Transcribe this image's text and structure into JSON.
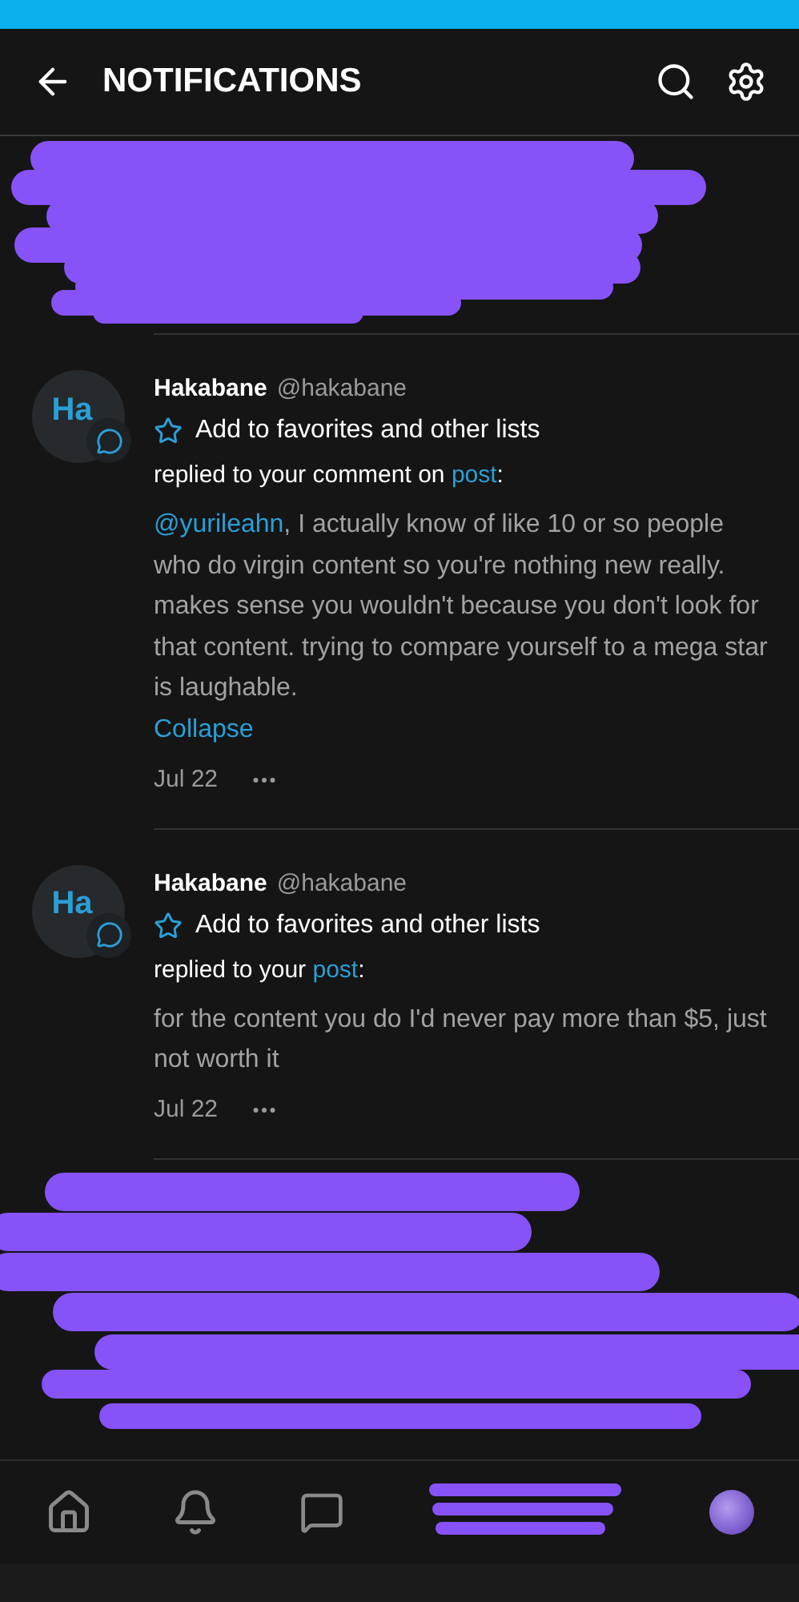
{
  "header": {
    "title": "NOTIFICATIONS"
  },
  "notifications": [
    {
      "avatar_initials": "Ha",
      "name": "Hakabane",
      "handle": "@hakabane",
      "favorites_label": "Add to favorites and other lists",
      "action_prefix": "replied to your comment on ",
      "action_link": "post",
      "action_suffix": ":",
      "mention": "@yurileahn",
      "body": ", I actually know of like 10 or so people who do virgin content so you're nothing new really. makes sense you wouldn't because you don't look for that content. trying to compare yourself to a mega star is laughable.",
      "toggle_link": "Collapse",
      "date": "Jul 22"
    },
    {
      "avatar_initials": "Ha",
      "name": "Hakabane",
      "handle": "@hakabane",
      "favorites_label": "Add to favorites and other lists",
      "action_prefix": "replied to your ",
      "action_link": "post",
      "action_suffix": ":",
      "body": "for the content you do I'd never pay more than $5, just not worth it",
      "date": "Jul 22"
    }
  ]
}
